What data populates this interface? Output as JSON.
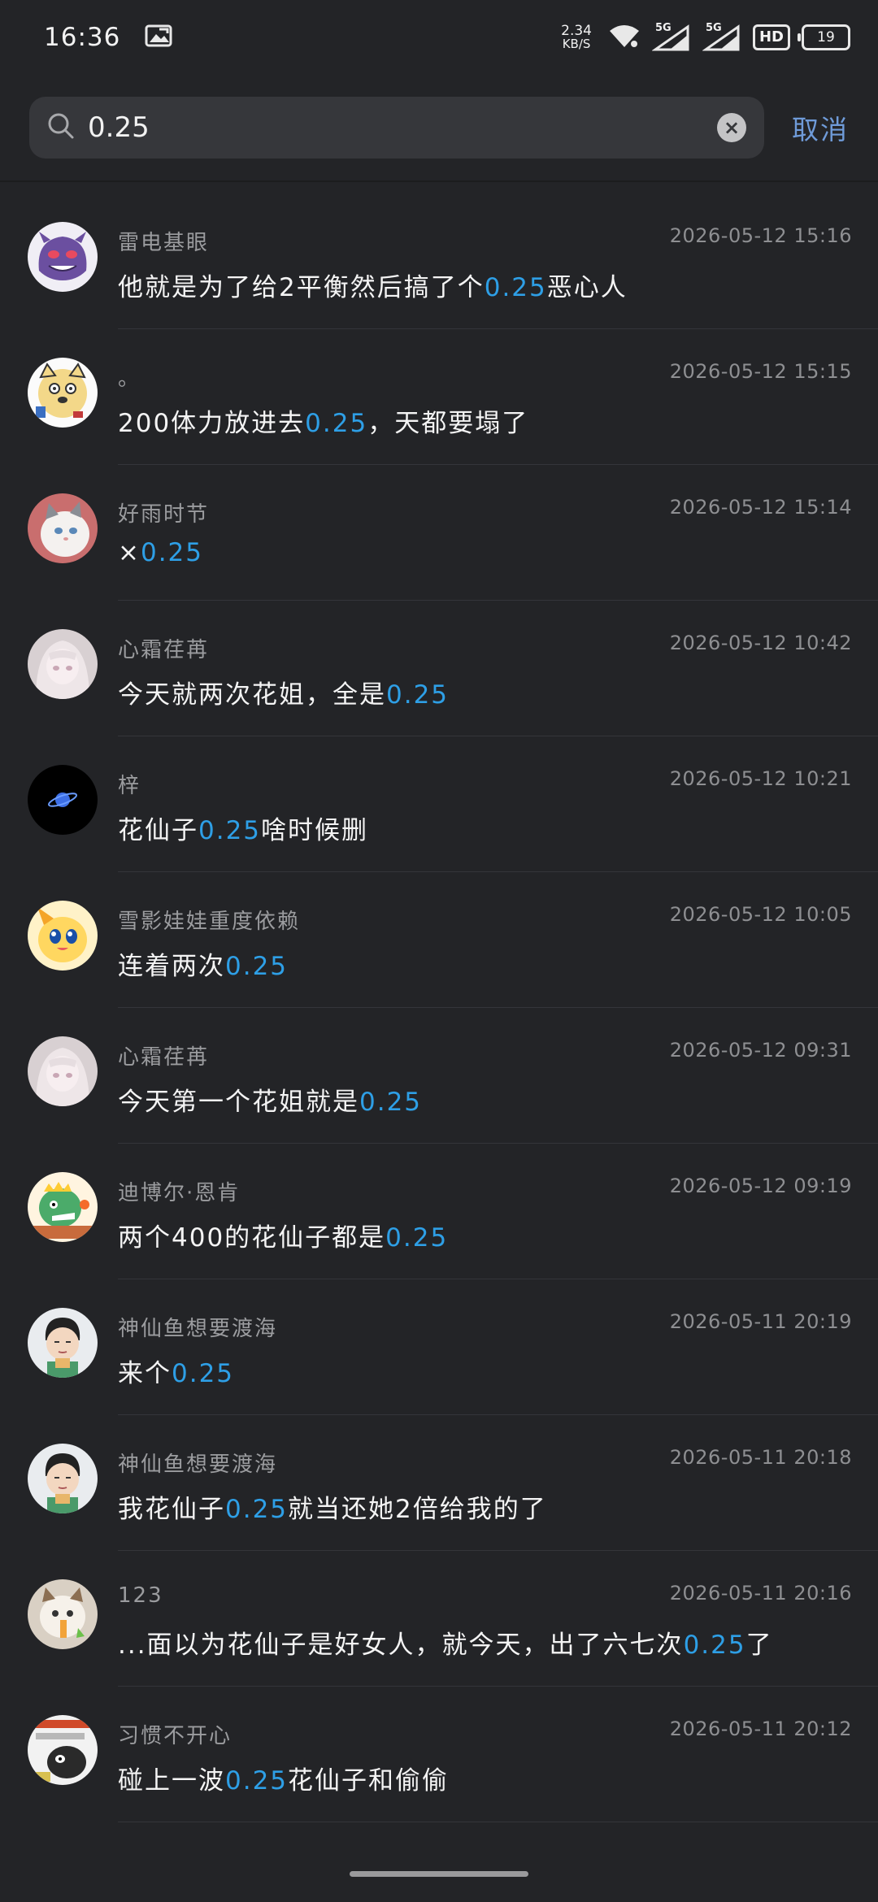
{
  "status_bar": {
    "time": "16:36",
    "net_speed_value": "2.34",
    "net_speed_unit": "KB/S",
    "signal1": "5G",
    "signal2": "5G",
    "hd": "HD",
    "battery": "19"
  },
  "search": {
    "query": "0.25",
    "cancel_label": "取消"
  },
  "colors": {
    "highlight": "#2e9fe6",
    "background": "#232427"
  },
  "results": [
    {
      "name": "雷电基眼",
      "time": "2026-05-12 15:16",
      "before": "他就是为了给2平衡然后搞了个",
      "hl": "0.25",
      "after": "恶心人",
      "avatar": "gengar-avatar"
    },
    {
      "name": "。",
      "time": "2026-05-12 15:15",
      "before": "200体力放进去",
      "hl": "0.25",
      "after": "，天都要塌了",
      "avatar": "doge-avatar"
    },
    {
      "name": "好雨时节",
      "time": "2026-05-12 15:14",
      "before": "×",
      "hl": "0.25",
      "after": "",
      "avatar": "cat-avatar"
    },
    {
      "name": "心霜荏苒",
      "time": "2026-05-12 10:42",
      "before": "今天就两次花姐，全是",
      "hl": "0.25",
      "after": "",
      "avatar": "anime-girl-avatar"
    },
    {
      "name": "梓",
      "time": "2026-05-12 10:21",
      "before": "花仙子",
      "hl": "0.25",
      "after": "啥时候删",
      "avatar": "planet-avatar"
    },
    {
      "name": "雪影娃娃重度依赖",
      "time": "2026-05-12 10:05",
      "before": "连着两次",
      "hl": "0.25",
      "after": "",
      "avatar": "cartoon-avatar"
    },
    {
      "name": "心霜荏苒",
      "time": "2026-05-12 09:31",
      "before": "今天第一个花姐就是",
      "hl": "0.25",
      "after": "",
      "avatar": "anime-girl-avatar"
    },
    {
      "name": "迪博尔·恩肯",
      "time": "2026-05-12 09:19",
      "before": "两个400的花仙子都是",
      "hl": "0.25",
      "after": "",
      "avatar": "dino-avatar"
    },
    {
      "name": "神仙鱼想要渡海",
      "time": "2026-05-11 20:19",
      "before": "来个",
      "hl": "0.25",
      "after": "",
      "avatar": "boy-avatar"
    },
    {
      "name": "神仙鱼想要渡海",
      "time": "2026-05-11 20:18",
      "before": "我花仙子",
      "hl": "0.25",
      "after": "就当还她2倍给我的了",
      "avatar": "boy-avatar"
    },
    {
      "name": "123",
      "time": "2026-05-11 20:16",
      "before": "...面以为花仙子是好女人，就今天，出了六七次",
      "hl": "0.25",
      "after": "了",
      "avatar": "cat-meme-avatar"
    },
    {
      "name": "习惯不开心",
      "time": "2026-05-11 20:12",
      "before": "碰上一波",
      "hl": "0.25",
      "after": "花仙子和偷偷",
      "avatar": "meme-avatar"
    }
  ]
}
